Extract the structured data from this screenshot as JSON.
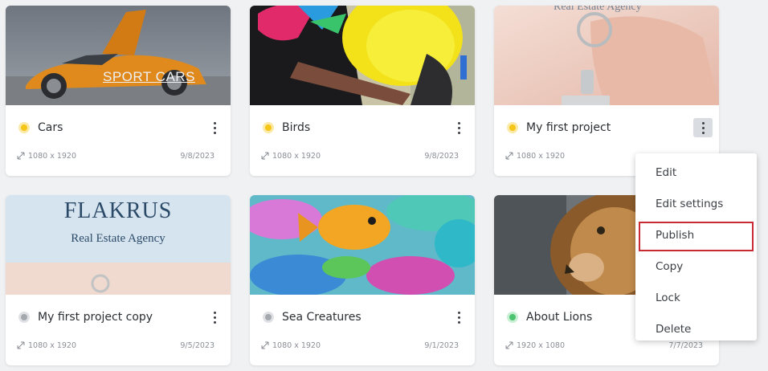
{
  "cards": [
    {
      "title": "Cars",
      "resolution": "1080 x 1920",
      "date": "9/8/2023",
      "status": "yellow",
      "overlay_text": "SPORT CARS"
    },
    {
      "title": "Birds",
      "resolution": "1080 x 1920",
      "date": "9/8/2023",
      "status": "yellow"
    },
    {
      "title": "My first project",
      "resolution": "1080 x 1920",
      "date": "",
      "status": "yellow",
      "overlay_text": "Real Estate Agency"
    },
    {
      "title": "My first project copy",
      "resolution": "1080 x 1920",
      "date": "9/5/2023",
      "status": "gray",
      "overlay_title": "FLAKRUS",
      "overlay_subtitle": "Real Estate Agency"
    },
    {
      "title": "Sea Creatures",
      "resolution": "1080 x 1920",
      "date": "9/1/2023",
      "status": "gray"
    },
    {
      "title": "About Lions",
      "resolution": "1920 x 1080",
      "date": "7/7/2023",
      "status": "green"
    }
  ],
  "status_colors": {
    "yellow": "#f5c518",
    "gray": "#a4a9b0",
    "green": "#4cc36e"
  },
  "context_menu": {
    "items": [
      "Edit",
      "Edit settings",
      "Publish",
      "Copy",
      "Lock",
      "Delete"
    ],
    "highlighted": "Publish",
    "highlight_color": "#c82b33"
  }
}
